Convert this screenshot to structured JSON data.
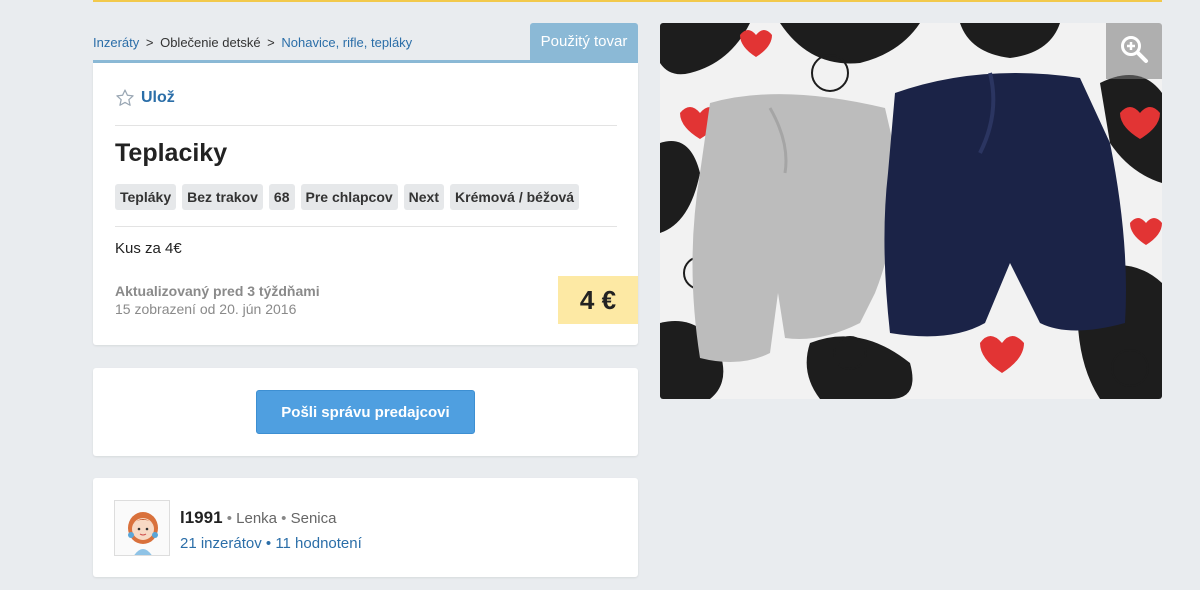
{
  "breadcrumb": {
    "items": [
      "Inzeráty",
      "Oblečenie detské",
      "Nohavice, rifle, tepláky"
    ],
    "separator": ">"
  },
  "condition_badge": "Použitý tovar",
  "save_label": "Ulož",
  "title": "Teplaciky",
  "tags": [
    "Tepláky",
    "Bez trakov",
    "68",
    "Pre chlapcov",
    "Next",
    "Krémová / béžová"
  ],
  "description": "Kus za 4€",
  "updated": "Aktualizovaný pred 3 týždňami",
  "views": "15 zobrazení od 20. jún 2016",
  "price": "4 €",
  "message_button": "Pošli správu predajcovi",
  "seller": {
    "username": "l1991",
    "name": "Lenka",
    "city": "Senica",
    "listings": "21 inzerátov",
    "ratings": "11 hodnotení"
  },
  "colors": {
    "accent": "#2b6ea8",
    "badge": "#8bb9d6",
    "price_bg": "#fde9a4",
    "button": "#4f9fe0",
    "top_line": "#f2c94c"
  },
  "icons": {
    "save": "star-outline-icon",
    "zoom": "zoom-in-icon"
  }
}
